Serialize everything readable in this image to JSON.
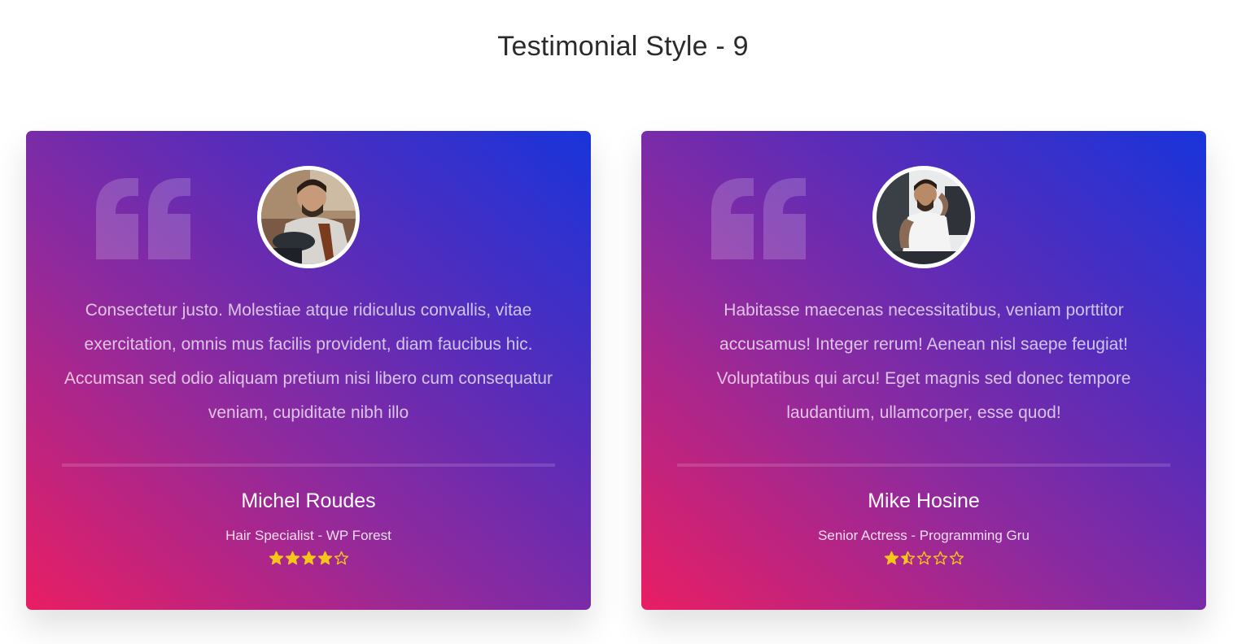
{
  "page": {
    "title": "Testimonial Style - 9"
  },
  "colors": {
    "star": "#f5c518",
    "gradient_start": "#e91e63",
    "gradient_end": "#1834db"
  },
  "testimonials": [
    {
      "avatar": "person-photo-barber",
      "quote_icon": "quote-icon",
      "text": "Consectetur justo. Molestiae atque ridiculus convallis, vitae exercitation, omnis mus facilis provident, diam faucibus hic. Accumsan sed odio aliquam pretium nisi libero cum consequatur veniam, cupiditate nibh illo",
      "name": "Michel Roudes",
      "role": "Hair Specialist - WP Forest",
      "rating": 4
    },
    {
      "avatar": "person-photo-tattooed-man",
      "quote_icon": "quote-icon",
      "text": "Habitasse maecenas necessitatibus, veniam porttitor accusamus! Integer rerum! Aenean nisl saepe feugiat! Voluptatibus qui arcu! Eget magnis sed donec tempore laudantium, ullamcorper, esse quod!",
      "name": "Mike Hosine",
      "role": "Senior Actress - Programming Gru",
      "rating": 1.5
    }
  ]
}
